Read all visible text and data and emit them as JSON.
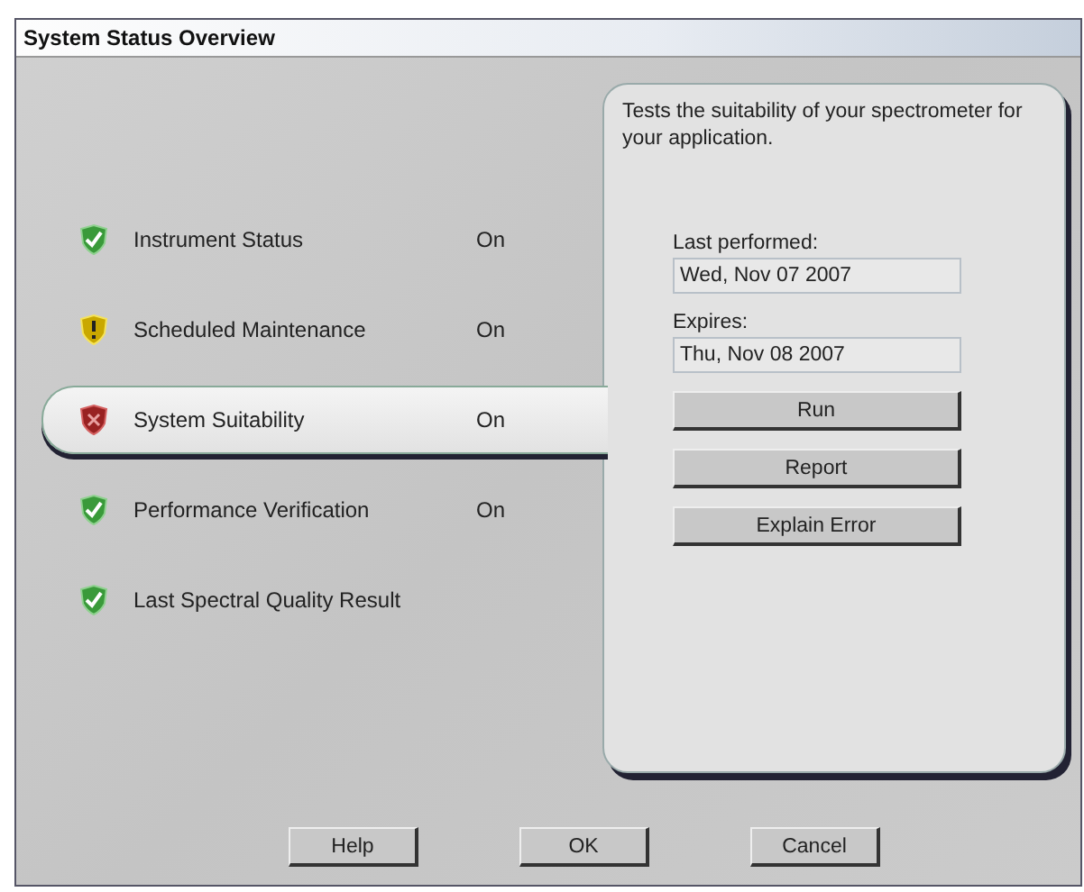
{
  "window": {
    "title": "System Status Overview"
  },
  "items": [
    {
      "label": "Instrument Status",
      "value": "On",
      "kind": "ok",
      "selected": false
    },
    {
      "label": "Scheduled Maintenance",
      "value": "On",
      "kind": "warning",
      "selected": false
    },
    {
      "label": "System Suitability",
      "value": "On",
      "kind": "error",
      "selected": true
    },
    {
      "label": "Performance Verification",
      "value": "On",
      "kind": "ok",
      "selected": false
    },
    {
      "label": "Last Spectral Quality Result",
      "kind": "ok",
      "selected": false
    }
  ],
  "detail": {
    "description": "Tests the suitability of your spectrometer for your application.",
    "fields": [
      {
        "label": "Last performed:",
        "value": "Wed, Nov 07 2007"
      },
      {
        "label": "Expires:",
        "value": "Thu, Nov 08 2007"
      }
    ],
    "buttons": [
      "Run",
      "Report",
      "Explain Error"
    ]
  },
  "footer_buttons": [
    "Help",
    "OK",
    "Cancel"
  ]
}
